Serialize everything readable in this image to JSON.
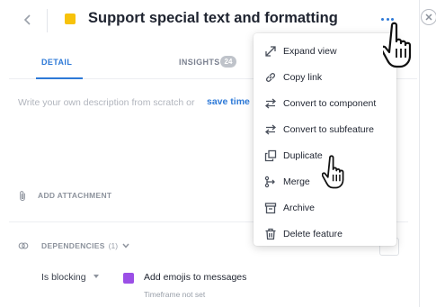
{
  "header": {
    "title": "Support special text and formatting",
    "back_icon": "chevron-left-icon",
    "more_icon": "ellipsis-horizontal-icon",
    "close_icon": "close-icon",
    "swatch_color": "#f7c20b",
    "accent_color": "#2d79d7"
  },
  "tabs": [
    {
      "label": "DETAIL",
      "active": true
    },
    {
      "label": "INSIGHTS",
      "badge": "24",
      "active": false
    }
  ],
  "description": {
    "placeholder": "Write your own description from scratch or",
    "link": "save time"
  },
  "attachment": {
    "label": "ADD ATTACHMENT",
    "icon": "paperclip-icon"
  },
  "dependencies": {
    "label": "DEPENDENCIES",
    "count": "(1)",
    "icon": "link-chain-icon",
    "relation": "Is blocking",
    "feature": {
      "name": "Add emojis to messages",
      "timeframe": "Timeframe not set",
      "swatch_color": "#9b4fe6"
    }
  },
  "menu": {
    "items": [
      {
        "label": "Expand view",
        "icon": "expand-icon"
      },
      {
        "label": "Copy link",
        "icon": "link-icon"
      },
      {
        "label": "Convert to component",
        "icon": "swap-arrows-icon"
      },
      {
        "label": "Convert to subfeature",
        "icon": "swap-arrows-icon"
      },
      {
        "label": "Duplicate",
        "icon": "duplicate-icon"
      },
      {
        "label": "Merge",
        "icon": "merge-icon"
      },
      {
        "label": "Archive",
        "icon": "archive-icon"
      },
      {
        "label": "Delete feature",
        "icon": "trash-icon"
      }
    ]
  }
}
